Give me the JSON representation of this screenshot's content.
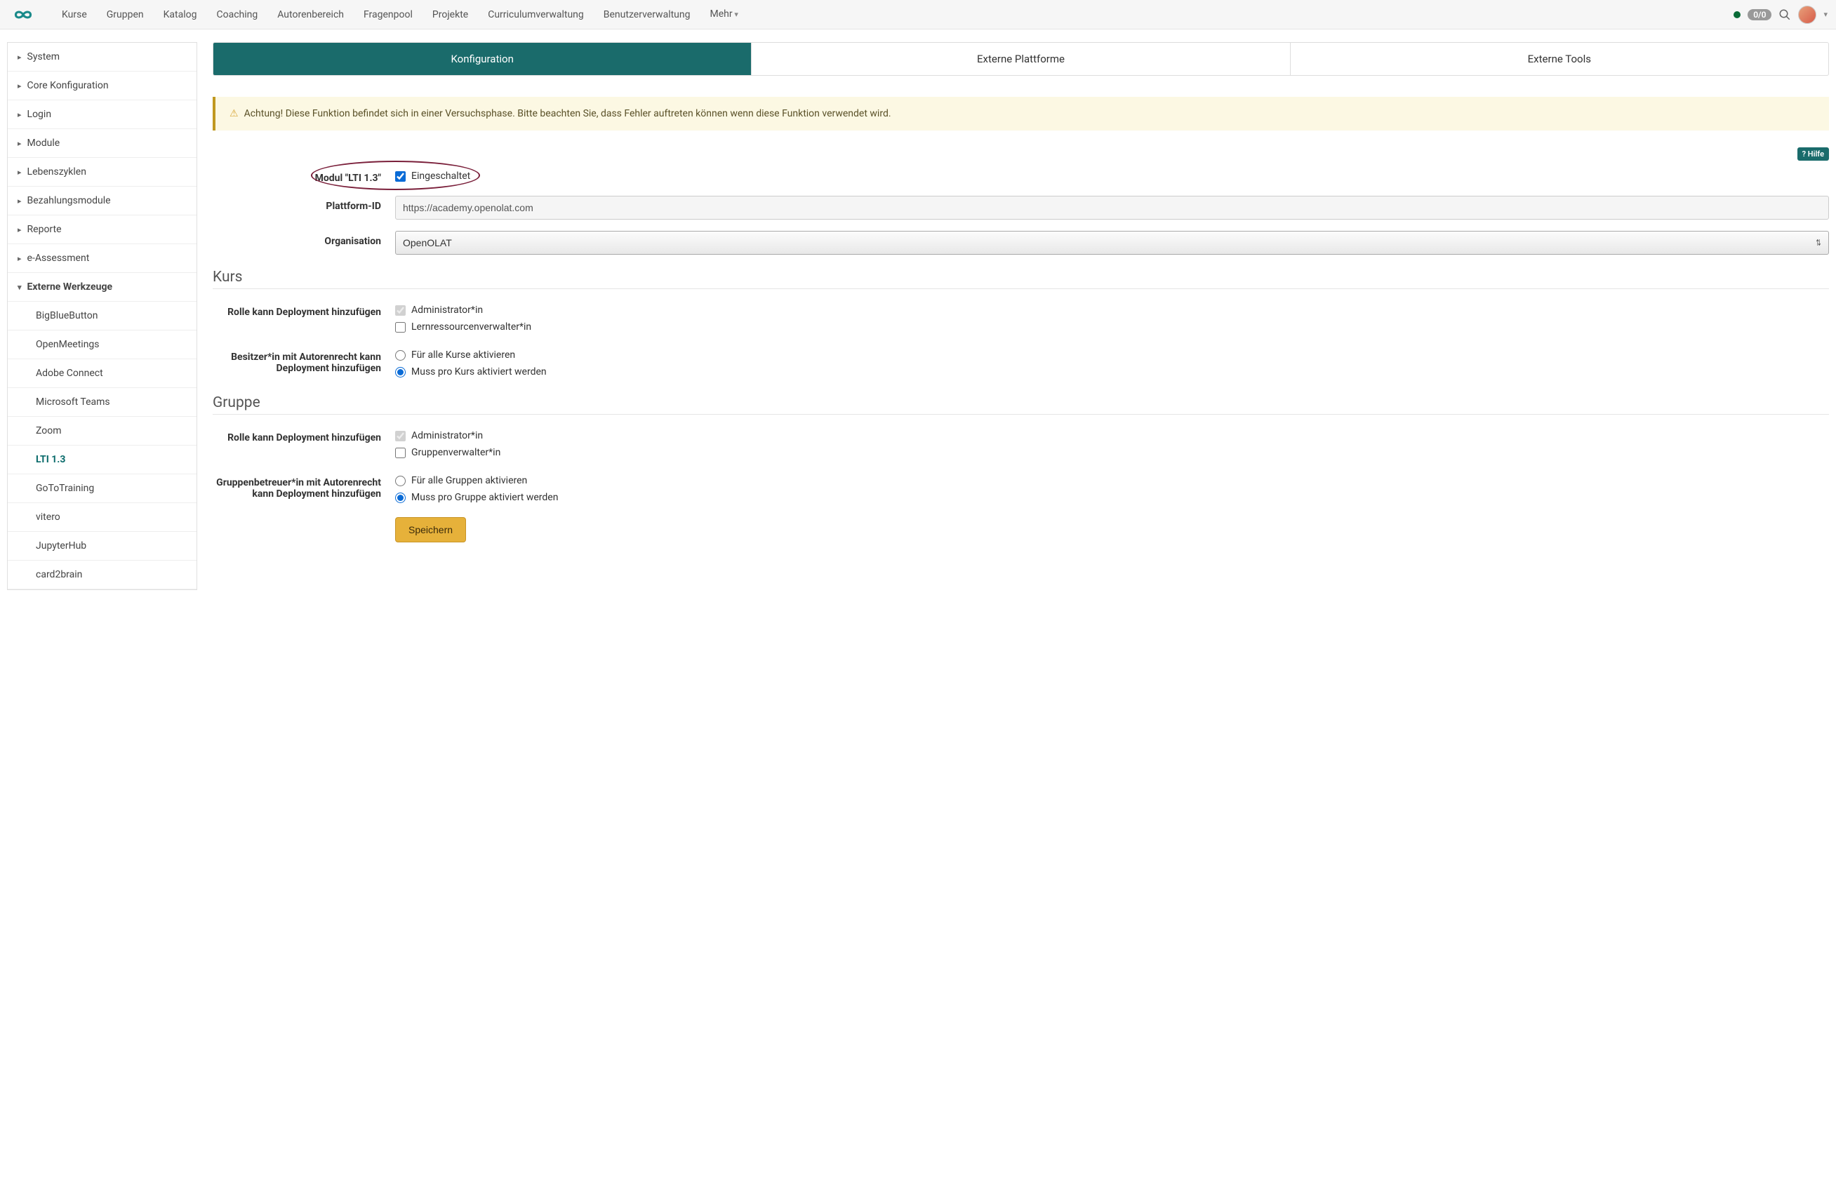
{
  "topnav": {
    "items": [
      "Kurse",
      "Gruppen",
      "Katalog",
      "Coaching",
      "Autorenbereich",
      "Fragenpool",
      "Projekte",
      "Curriculumverwaltung",
      "Benutzerverwaltung"
    ],
    "more_label": "Mehr",
    "badge": "0/0"
  },
  "sidebar": {
    "groups": [
      {
        "label": "System",
        "expandable": true
      },
      {
        "label": "Core Konfiguration",
        "expandable": true
      },
      {
        "label": "Login",
        "expandable": true
      },
      {
        "label": "Module",
        "expandable": true
      },
      {
        "label": "Lebenszyklen",
        "expandable": true
      },
      {
        "label": "Bezahlungsmodule",
        "expandable": true
      },
      {
        "label": "Reporte",
        "expandable": true
      },
      {
        "label": "e-Assessment",
        "expandable": true
      }
    ],
    "expanded_group": {
      "label": "Externe Werkzeuge"
    },
    "subitems": [
      {
        "label": "BigBlueButton"
      },
      {
        "label": "OpenMeetings"
      },
      {
        "label": "Adobe Connect"
      },
      {
        "label": "Microsoft Teams"
      },
      {
        "label": "Zoom"
      },
      {
        "label": "LTI 1.3",
        "active": true
      },
      {
        "label": "GoToTraining"
      },
      {
        "label": "vitero"
      },
      {
        "label": "JupyterHub"
      },
      {
        "label": "card2brain"
      }
    ]
  },
  "tabs": [
    {
      "label": "Konfiguration",
      "active": true
    },
    {
      "label": "Externe Plattforme"
    },
    {
      "label": "Externe Tools"
    }
  ],
  "alert": {
    "text": "Achtung! Diese Funktion befindet sich in einer Versuchsphase. Bitte beachten Sie, dass Fehler auftreten können wenn diese Funktion verwendet wird."
  },
  "help_label": "Hilfe",
  "form": {
    "module_label": "Modul \"LTI 1.3\"",
    "module_checkbox_label": "Eingeschaltet",
    "platform_id_label": "Plattform-ID",
    "platform_id_value": "https://academy.openolat.com",
    "organisation_label": "Organisation",
    "organisation_value": "OpenOLAT",
    "kurs_heading": "Kurs",
    "kurs_role_label": "Rolle kann Deployment hinzufügen",
    "kurs_role_options": [
      {
        "label": "Administrator*in",
        "checked": true,
        "disabled": true
      },
      {
        "label": "Lernressourcenverwalter*in",
        "checked": false
      }
    ],
    "kurs_owner_label": "Besitzer*in mit Autorenrecht kann Deployment hinzufügen",
    "kurs_owner_options": [
      {
        "label": "Für alle Kurse aktivieren",
        "selected": false
      },
      {
        "label": "Muss pro Kurs aktiviert werden",
        "selected": true
      }
    ],
    "gruppe_heading": "Gruppe",
    "gruppe_role_label": "Rolle kann Deployment hinzufügen",
    "gruppe_role_options": [
      {
        "label": "Administrator*in",
        "checked": true,
        "disabled": true
      },
      {
        "label": "Gruppenverwalter*in",
        "checked": false
      }
    ],
    "gruppe_coach_label": "Gruppenbetreuer*in mit Autorenrecht kann Deployment hinzufügen",
    "gruppe_coach_options": [
      {
        "label": "Für alle Gruppen aktivieren",
        "selected": false
      },
      {
        "label": "Muss pro Gruppe aktiviert werden",
        "selected": true
      }
    ],
    "save_label": "Speichern"
  }
}
